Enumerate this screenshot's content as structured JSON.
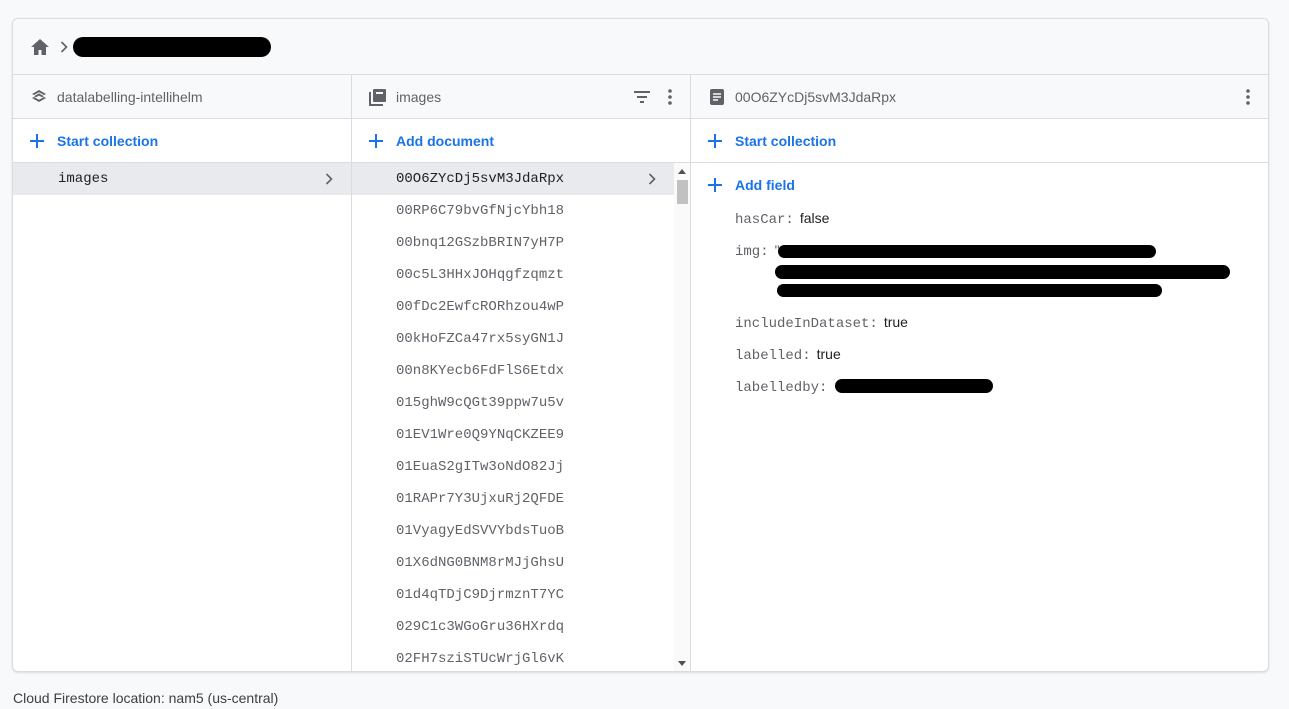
{
  "breadcrumb": {
    "home_icon": "home-icon",
    "separator_icon": "chevron-right-icon"
  },
  "columns": {
    "root": {
      "title": "datalabelling-intellihelm",
      "icon": "database-stack-icon",
      "action_label": "Start collection",
      "items": [
        {
          "label": "images"
        }
      ]
    },
    "collection": {
      "title": "images",
      "icon": "collection-icon",
      "action_label": "Add document",
      "items": [
        {
          "label": "00O6ZYcDj5svM3JdaRpx"
        },
        {
          "label": "00RP6C79bvGfNjcYbh18"
        },
        {
          "label": "00bnq12GSzbBRIN7yH7P"
        },
        {
          "label": "00c5L3HHxJOHqgfzqmzt"
        },
        {
          "label": "00fDc2EwfcRORhzou4wP"
        },
        {
          "label": "00kHoFZCa47rx5syGN1J"
        },
        {
          "label": "00n8KYecb6FdFlS6Etdx"
        },
        {
          "label": "015ghW9cQGt39ppw7u5v"
        },
        {
          "label": "01EV1Wre0Q9YNqCKZEE9"
        },
        {
          "label": "01EuaS2gITw3oNdO82Jj"
        },
        {
          "label": "01RAPr7Y3UjxuRj2QFDE"
        },
        {
          "label": "01VyagyEdSVVYbdsTuoB"
        },
        {
          "label": "01X6dNG0BNM8rMJjGhsU"
        },
        {
          "label": "01d4qTDjC9DjrmznT7YC"
        },
        {
          "label": "029C1c3WGoGru36HXrdq"
        },
        {
          "label": "02FH7sziSTUcWrjGl6vK"
        }
      ]
    },
    "document": {
      "title": "00O6ZYcDj5svM3JdaRpx",
      "icon": "document-icon",
      "action_label": "Start collection",
      "add_field_label": "Add field",
      "fields": [
        {
          "key": "hasCar:",
          "value": "false"
        },
        {
          "key": "img:",
          "value": "\""
        },
        {
          "key": "includeInDataset:",
          "value": "true"
        },
        {
          "key": "labelled:",
          "value": "true"
        },
        {
          "key": "labelledby:",
          "value": ""
        }
      ]
    }
  },
  "footer": {
    "location_text": "Cloud Firestore location: nam5 (us-central)"
  },
  "colors": {
    "accent": "#1a73e8",
    "selected_bg": "#e8eaed",
    "border": "#dadce0"
  }
}
